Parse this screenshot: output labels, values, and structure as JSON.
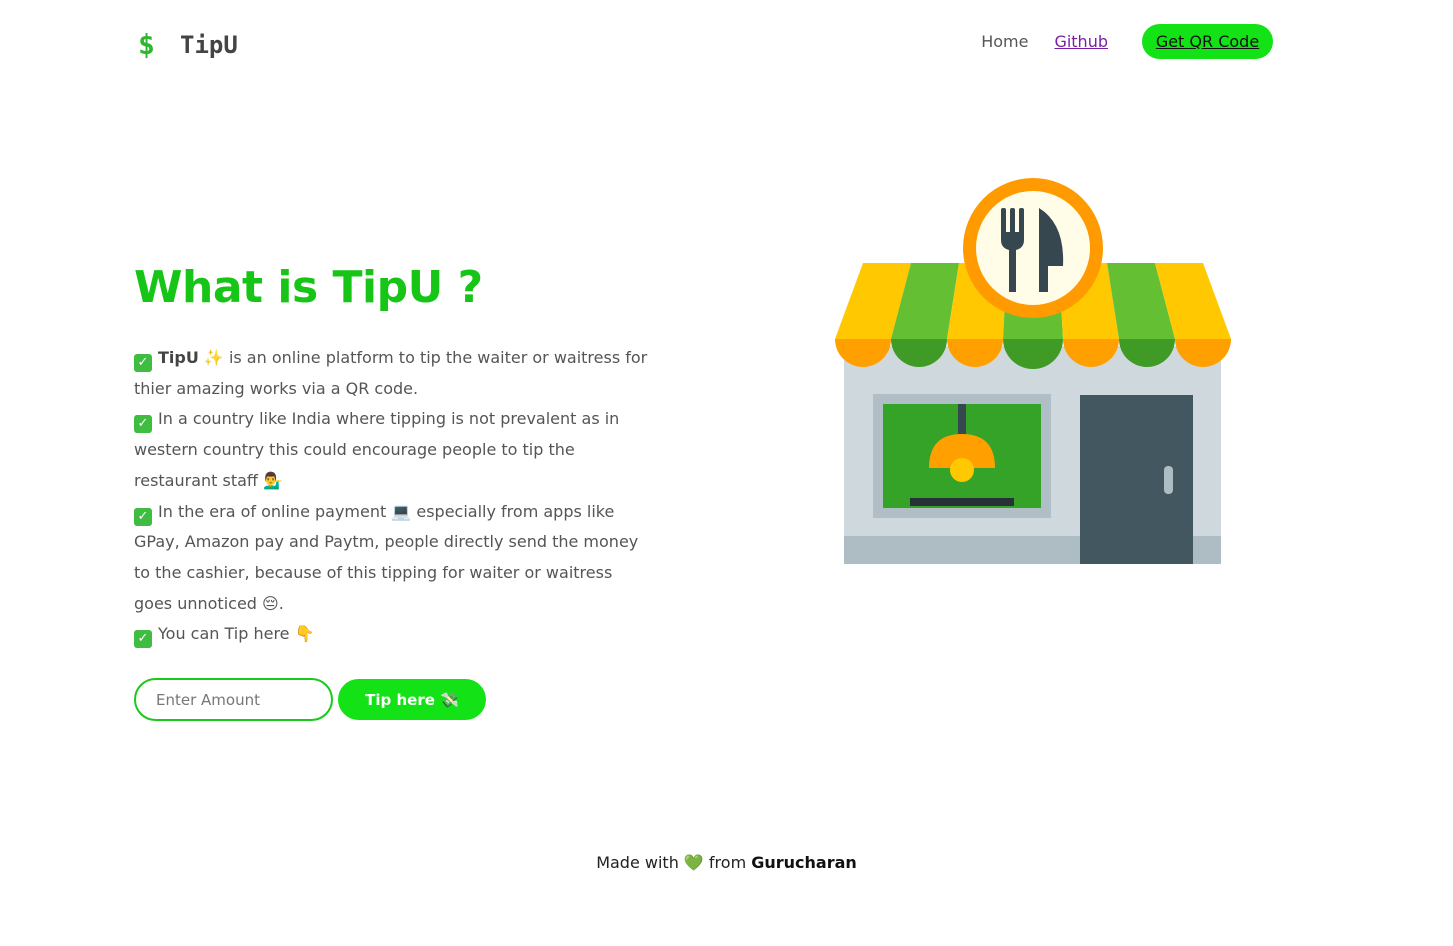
{
  "header": {
    "brand_icon": "$",
    "brand_name": "TipU",
    "nav": {
      "home": "Home",
      "github": "Github",
      "qr": "Get QR Code"
    }
  },
  "hero": {
    "title": "What is TipU ?",
    "points": [
      {
        "check": "✓",
        "bold": "TipU",
        "text": " ✨ is an online platform to tip the waiter or waitress for thier amazing works via a QR code."
      },
      {
        "check": "✓",
        "text": "In a country like India where tipping is not prevalent as in western country this could encourage people to tip the restaurant staff 💁‍♂️"
      },
      {
        "check": "✓",
        "text": "In the era of online payment 💻 especially from apps like GPay, Amazon pay and Paytm, people directly send the money to the cashier, because of this tipping for waiter or waitress goes unnoticed 😔."
      },
      {
        "check": "✓",
        "text": "You can Tip here 👇"
      }
    ]
  },
  "tip_form": {
    "placeholder": "Enter Amount",
    "button_label": "Tip here 💸"
  },
  "illustration": {
    "icon": "restaurant-storefront-icon",
    "colors": {
      "awning_yellow": "#ffc800",
      "awning_green": "#64c032",
      "wall": "#cfd8dc",
      "door": "#42575f",
      "window_bg": "#35a228",
      "sign_ring": "#ff9b00"
    }
  },
  "footer": {
    "prefix": "Made with 💚 from ",
    "author": "Gurucharan"
  },
  "colors": {
    "accent": "#13e316",
    "title_green": "#17c517",
    "link_purple": "#7b1fa2"
  }
}
